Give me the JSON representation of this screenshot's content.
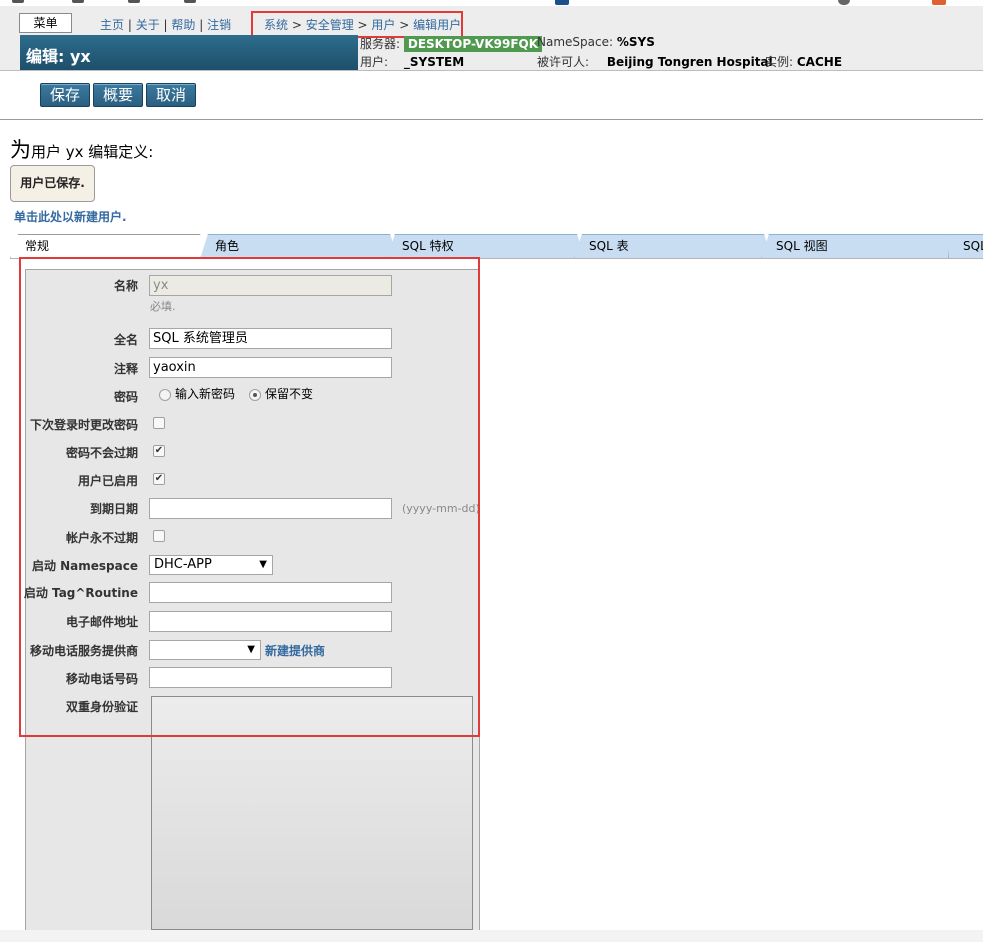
{
  "header": {
    "menu_label": "菜单",
    "nav": {
      "home": "主页",
      "about": "关于",
      "help": "帮助",
      "logout": "注销",
      "sep": " | "
    },
    "breadcrumb": {
      "system": "系统",
      "security": "安全管理",
      "users": "用户",
      "edit_user": "编辑用户",
      "sep": " > "
    },
    "page_title": "编辑: yx",
    "server_label": "服务器:",
    "server_value": "DESKTOP-VK99FQK",
    "namespace_label": "NameSpace:",
    "namespace_value": "%SYS",
    "user_label": "用户:",
    "user_value": "_SYSTEM",
    "licensee_label": "被许可人:",
    "licensee_value": "Beijing Tongren Hospital",
    "instance_label": "实例:",
    "instance_value": "CACHE"
  },
  "toolbar": {
    "save_label": "保存",
    "summary_label": "概要",
    "cancel_label": "取消"
  },
  "main": {
    "heading_prefix": "为",
    "heading_rest": "用户 yx 编辑定义:",
    "saved_message": "用户已保存.",
    "new_user_link": "单击此处以新建用户."
  },
  "tabs": [
    {
      "label": "常规"
    },
    {
      "label": "角色"
    },
    {
      "label": "SQL 特权"
    },
    {
      "label": "SQL 表"
    },
    {
      "label": "SQL 视图"
    },
    {
      "label": "SQL"
    }
  ],
  "form": {
    "name_label": "名称",
    "name_value": "yx",
    "name_hint": "必填.",
    "fullname_label": "全名",
    "fullname_value": "SQL 系统管理员",
    "comment_label": "注释",
    "comment_value": "yaoxin",
    "password_label": "密码",
    "password_opt_new": "输入新密码",
    "password_opt_keep": "保留不变",
    "change_on_login_label": "下次登录时更改密码",
    "pw_never_expires_label": "密码不会过期",
    "user_enabled_label": "用户已启用",
    "expiration_label": "到期日期",
    "expiration_value": "",
    "expiration_hint": "(yyyy-mm-dd)",
    "account_never_expires_label": "帐户永不过期",
    "startup_ns_label": "启动 Namespace",
    "startup_ns_value": "DHC-APP",
    "startup_routine_label": "启动 Tag^Routine",
    "startup_routine_value": "",
    "email_label": "电子邮件地址",
    "email_value": "",
    "mobile_provider_label": "移动电话服务提供商",
    "mobile_provider_value": "",
    "new_provider_link": "新建提供商",
    "mobile_phone_label": "移动电话号码",
    "mobile_phone_value": "",
    "two_factor_label": "双重身份验证",
    "checkmark": "✔"
  },
  "colors": {
    "accent": "#2e6d8e",
    "link": "#356aa0",
    "highlight": "#e03a3a",
    "server_tag": "#4f9a4f"
  }
}
